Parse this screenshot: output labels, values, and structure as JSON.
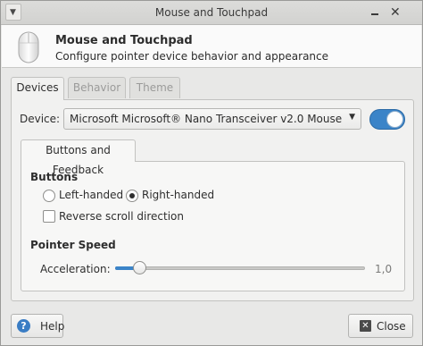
{
  "window": {
    "title": "Mouse and Touchpad"
  },
  "header": {
    "title": "Mouse and Touchpad",
    "subtitle": "Configure pointer device behavior and appearance"
  },
  "tabs": [
    {
      "label": "Devices",
      "active": true
    },
    {
      "label": "Behavior",
      "active": false
    },
    {
      "label": "Theme",
      "active": false
    }
  ],
  "devices": {
    "device_label": "Device:",
    "device_value": "Microsoft Microsoft® Nano Transceiver v2.0 Mouse",
    "device_enabled": true,
    "inner_tab": "Buttons and Feedback",
    "buttons": {
      "heading": "Buttons",
      "left_handed_label": "Left-handed",
      "right_handed_label": "Right-handed",
      "selected": "right-handed",
      "reverse_scroll_label": "Reverse scroll direction",
      "reverse_scroll_checked": false
    },
    "pointer_speed": {
      "heading": "Pointer Speed",
      "acceleration_label": "Acceleration:",
      "acceleration_value": "1,0",
      "acceleration_fraction": 0.1
    }
  },
  "footer": {
    "help_label": "Help",
    "close_label": "Close"
  },
  "colors": {
    "accent": "#3b84c8",
    "window_bg": "#e8e8e7"
  },
  "icons": {
    "window_menu": "window-menu-icon",
    "minimize": "minimize-icon",
    "close": "close-icon",
    "mouse": "mouse-icon",
    "help": "help-icon",
    "dropdown": "chevron-down-icon"
  }
}
